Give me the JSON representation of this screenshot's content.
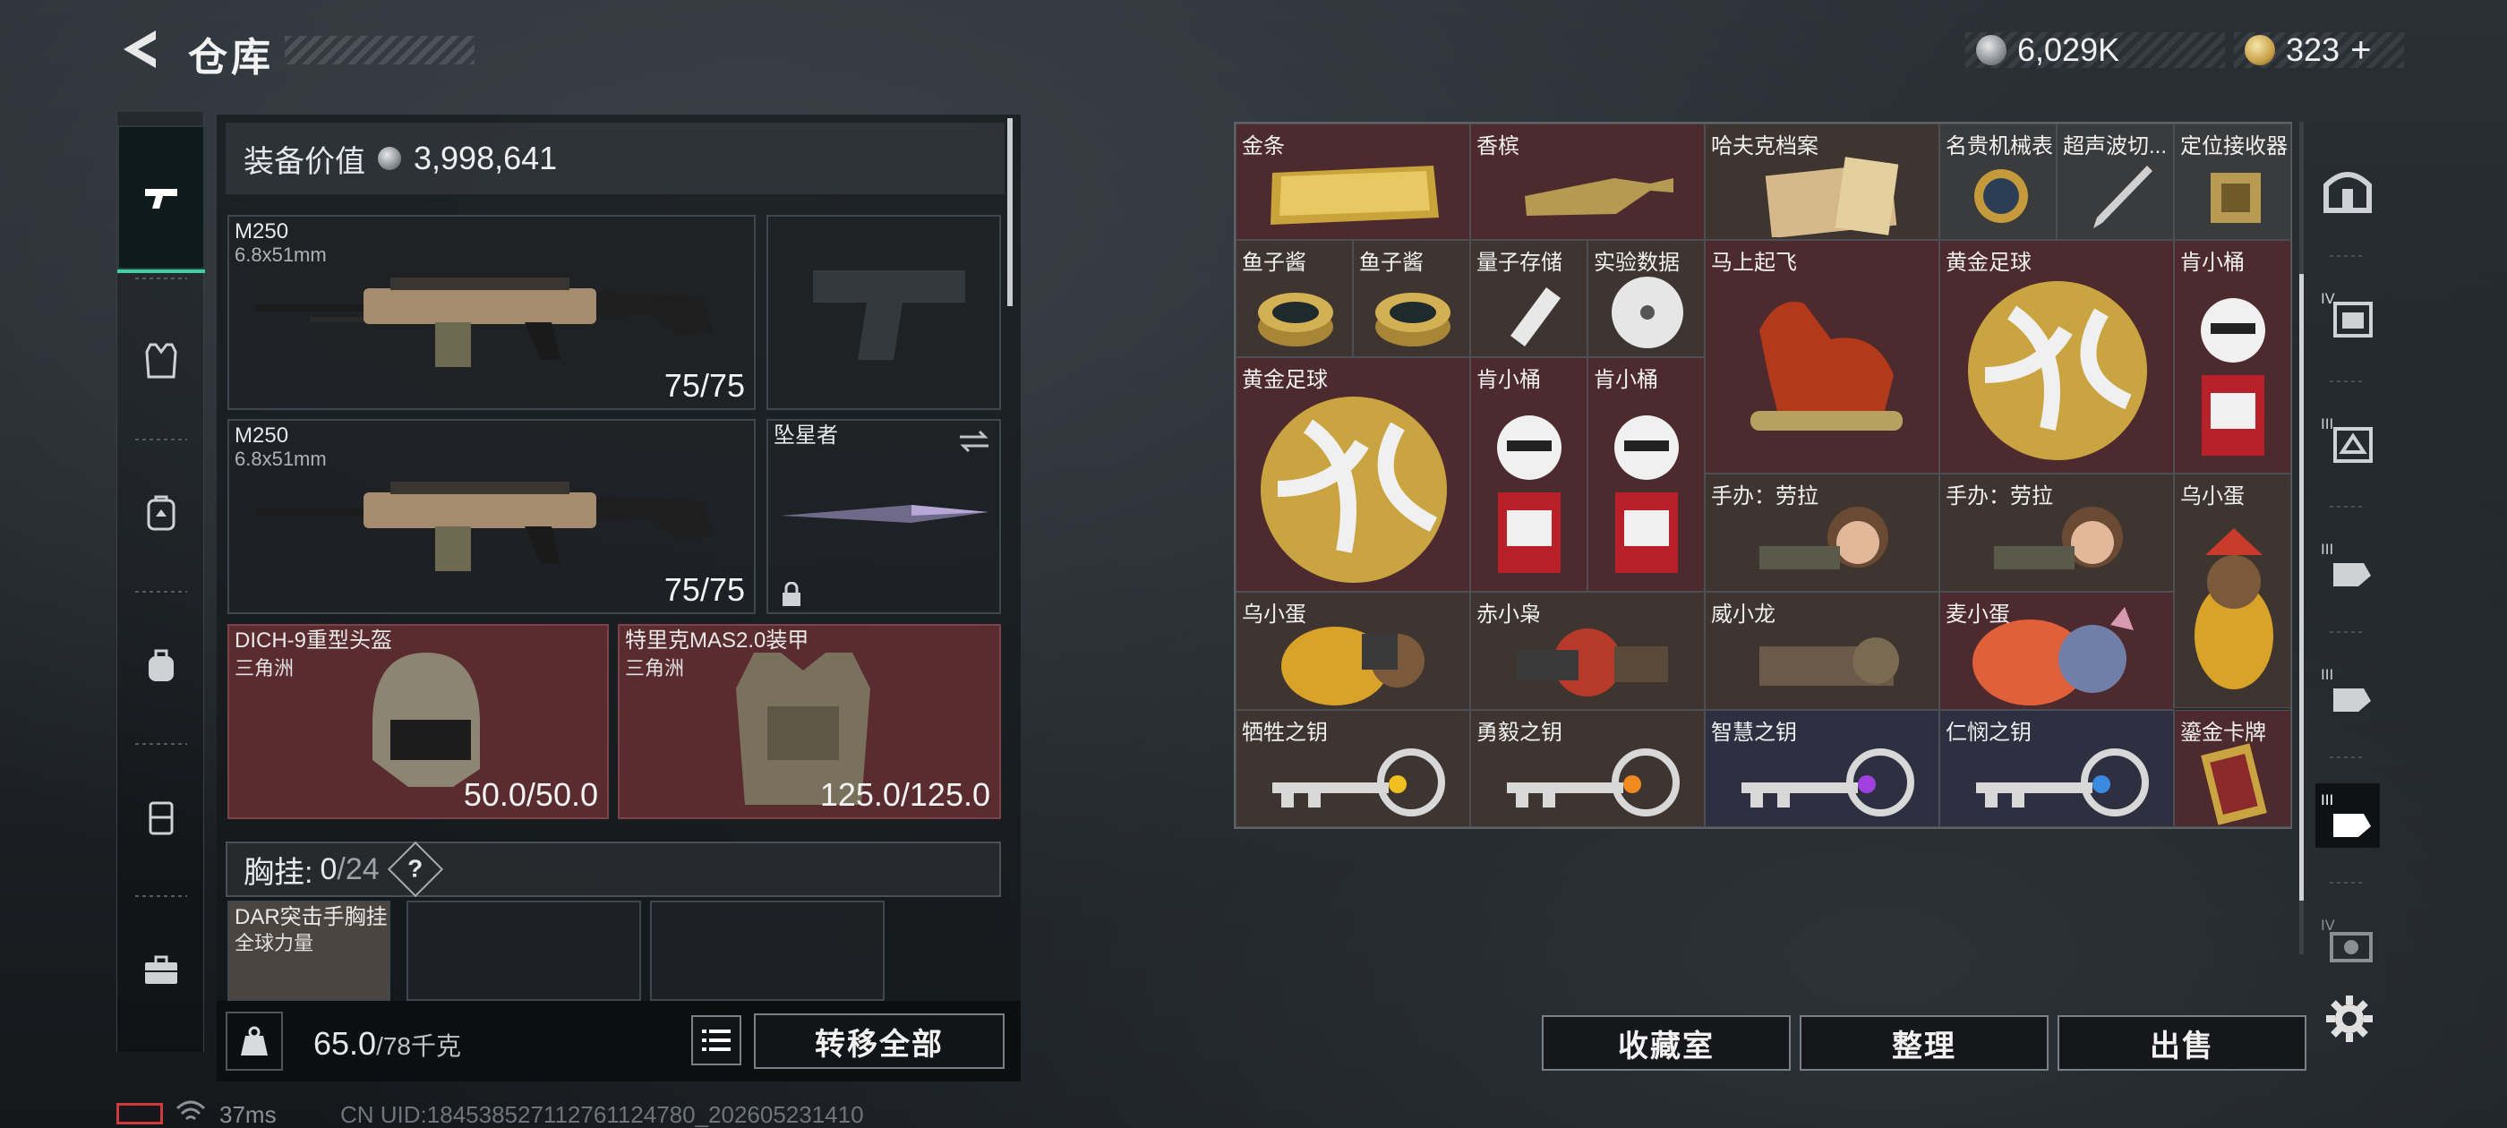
{
  "header": {
    "title": "仓库",
    "currency_silver": "6,029K",
    "currency_gold": "323",
    "plus": "+"
  },
  "loadout": {
    "value_label": "装备价值",
    "value": "3,998,641",
    "primary1": {
      "name": "M250",
      "ammo": "6.8x51mm",
      "count": "75/75"
    },
    "primary2": {
      "name": "M250",
      "ammo": "6.8x51mm",
      "count": "75/75"
    },
    "melee": {
      "name": "坠星者"
    },
    "helmet": {
      "name": "DICH-9重型头盔",
      "faction": "三角洲",
      "durability": "50.0/50.0"
    },
    "armor": {
      "name": "特里克MAS2.0装甲",
      "faction": "三角洲",
      "durability": "125.0/125.0"
    },
    "chest_rig": {
      "label": "胸挂:",
      "count": "0",
      "capacity": "/24",
      "help": "?"
    },
    "rig_item": {
      "name": "DAR突击手胸挂",
      "faction": "全球力量"
    },
    "weight": {
      "value": "65.0",
      "max": "/78千克"
    },
    "transfer_all": "转移全部"
  },
  "storage": {
    "items": [
      {
        "name": "金条"
      },
      {
        "name": "香槟"
      },
      {
        "name": "哈夫克档案"
      },
      {
        "name": "名贵机械表"
      },
      {
        "name": "超声波切..."
      },
      {
        "name": "定位接收器"
      },
      {
        "name": "鱼子酱"
      },
      {
        "name": "鱼子酱"
      },
      {
        "name": "量子存储"
      },
      {
        "name": "实验数据"
      },
      {
        "name": "马上起飞"
      },
      {
        "name": "黄金足球"
      },
      {
        "name": "肯小桶"
      },
      {
        "name": "黄金足球"
      },
      {
        "name": "肯小桶"
      },
      {
        "name": "肯小桶"
      },
      {
        "name": "手办：劳拉"
      },
      {
        "name": "手办：劳拉"
      },
      {
        "name": "乌小蛋"
      },
      {
        "name": "乌小蛋"
      },
      {
        "name": "赤小枭"
      },
      {
        "name": "威小龙"
      },
      {
        "name": "麦小蛋"
      },
      {
        "name": "牺牲之钥"
      },
      {
        "name": "勇毅之钥"
      },
      {
        "name": "智慧之钥"
      },
      {
        "name": "仁悯之钥"
      },
      {
        "name": "鎏金卡牌"
      }
    ],
    "buttons": {
      "collection": "收藏室",
      "sort": "整理",
      "sell": "出售"
    }
  },
  "status_bar": {
    "ping": "37ms",
    "uid": "CN UID:18453852711276112478​0_202605231410"
  }
}
